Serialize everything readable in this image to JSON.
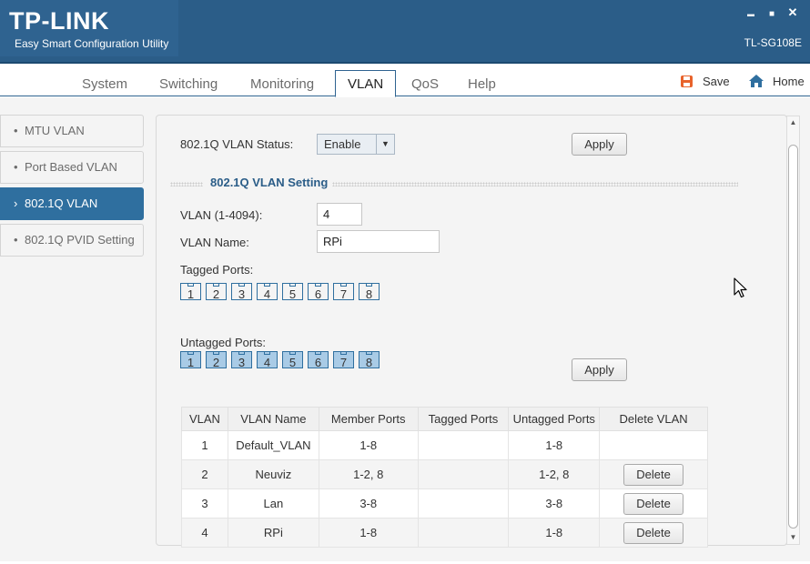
{
  "app": {
    "logo": "TP-LINK",
    "subtitle": "Easy Smart Configuration Utility",
    "model": "TL-SG108E"
  },
  "window_controls": {
    "minimize": "▬",
    "maximize": "■",
    "close": "✕"
  },
  "nav": {
    "tabs": [
      {
        "label": "System"
      },
      {
        "label": "Switching"
      },
      {
        "label": "Monitoring"
      },
      {
        "label": "VLAN"
      },
      {
        "label": "QoS"
      },
      {
        "label": "Help"
      }
    ],
    "active_tab": "VLAN",
    "save_label": "Save",
    "home_label": "Home"
  },
  "sidebar": {
    "items": [
      {
        "label": "MTU VLAN",
        "bullet": "•"
      },
      {
        "label": "Port Based VLAN",
        "bullet": "•"
      },
      {
        "label": "802.1Q VLAN",
        "bullet": "›"
      },
      {
        "label": "802.1Q PVID Setting",
        "bullet": "•"
      }
    ],
    "active_item": "802.1Q VLAN"
  },
  "status": {
    "label": "802.1Q VLAN Status:",
    "value": "Enable",
    "apply_label": "Apply"
  },
  "setting": {
    "title": "802.1Q VLAN Setting",
    "vlan_id_label": "VLAN (1-4094):",
    "vlan_id_value": "4",
    "vlan_name_label": "VLAN Name:",
    "vlan_name_value": "RPi",
    "tagged_label": "Tagged Ports:",
    "tagged_ports": [
      "1",
      "2",
      "3",
      "4",
      "5",
      "6",
      "7",
      "8"
    ],
    "untagged_label": "Untagged Ports:",
    "untagged_ports": [
      "1",
      "2",
      "3",
      "4",
      "5",
      "6",
      "7",
      "8"
    ],
    "apply_label": "Apply"
  },
  "table": {
    "headers": [
      "VLAN",
      "VLAN Name",
      "Member Ports",
      "Tagged Ports",
      "Untagged Ports",
      "Delete VLAN"
    ],
    "rows": [
      {
        "vlan": "1",
        "name": "Default_VLAN",
        "member": "1-8",
        "tagged": "",
        "untagged": "1-8",
        "delete": ""
      },
      {
        "vlan": "2",
        "name": "Neuviz",
        "member": "1-2, 8",
        "tagged": "",
        "untagged": "1-2, 8",
        "delete": "Delete"
      },
      {
        "vlan": "3",
        "name": "Lan",
        "member": "3-8",
        "tagged": "",
        "untagged": "3-8",
        "delete": "Delete"
      },
      {
        "vlan": "4",
        "name": "RPi",
        "member": "1-8",
        "tagged": "",
        "untagged": "1-8",
        "delete": "Delete"
      }
    ]
  },
  "colors": {
    "header_bg": "#2b5d88",
    "accent": "#2f6f9f",
    "untagged_fill": "#a9cbe6",
    "section_title": "#2b5d88"
  },
  "icons": {
    "save": "save-icon",
    "home": "home-icon",
    "cursor": "mouse-pointer-icon"
  }
}
